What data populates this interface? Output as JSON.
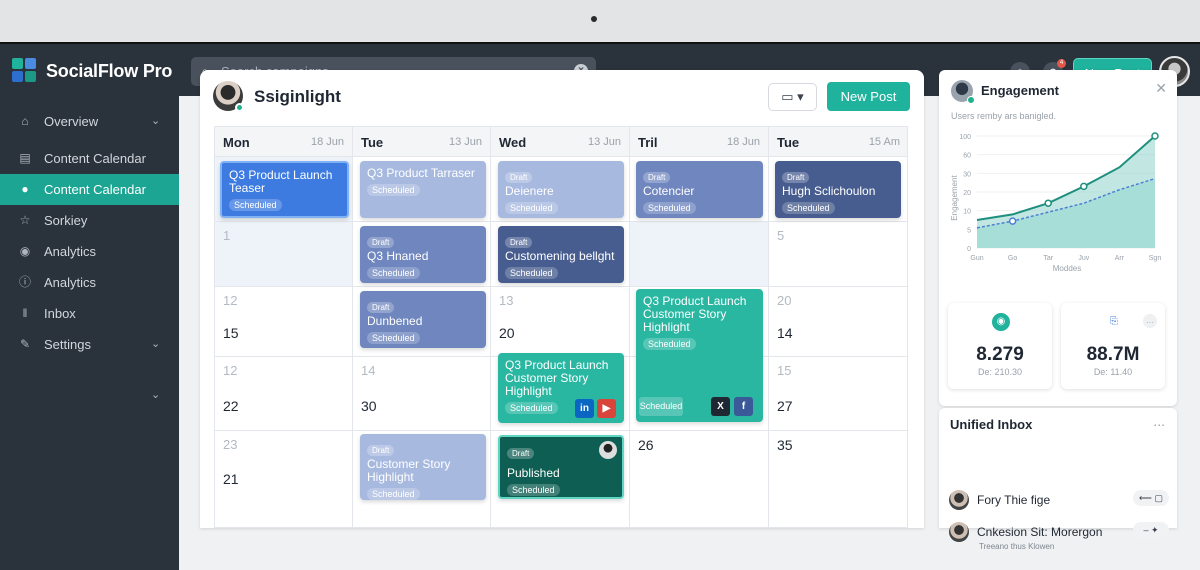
{
  "app": {
    "brand": "SocialFlow Pro"
  },
  "colors": {
    "accent": "#1fb29c",
    "sidebar": "#2a323c",
    "active": "#1ba592"
  },
  "search": {
    "placeholder": "Search campaigns"
  },
  "topbar": {
    "new_post": "New Post",
    "notif_count": "4"
  },
  "sidebar": {
    "items": [
      {
        "label": "Overview",
        "icon": "home-icon",
        "chevron": true
      },
      {
        "label": "Content Calendar",
        "icon": "calendar-icon",
        "chevron": false
      },
      {
        "label": "Content Calendar",
        "icon": "profile-icon",
        "chevron": false,
        "active": true
      },
      {
        "label": "Sorkiey",
        "icon": "star-icon",
        "chevron": false
      },
      {
        "label": "Analytics",
        "icon": "chat-icon",
        "chevron": false
      },
      {
        "label": "Analytics",
        "icon": "info-icon",
        "chevron": false
      },
      {
        "label": "Inbox",
        "icon": "bars-icon",
        "chevron": false
      },
      {
        "label": "Settings",
        "icon": "wrench-icon",
        "chevron": true
      }
    ]
  },
  "main": {
    "title": "Ssiginlight",
    "new_post": "New Post",
    "columns": [
      {
        "day": "Mon",
        "date": "18 Jun"
      },
      {
        "day": "Tue",
        "date": "13 Jun"
      },
      {
        "day": "Wed",
        "date": "13 Jun"
      },
      {
        "day": "Tril",
        "date": "18 Jun"
      },
      {
        "day": "Tue",
        "date": "15 Am"
      }
    ],
    "dates": {
      "r1": [
        "1",
        "",
        "",
        "",
        "5"
      ],
      "r2": [
        "12",
        "",
        "13",
        "",
        "20"
      ],
      "r2b": [
        "15",
        "",
        "20",
        "",
        "14"
      ],
      "r3": [
        "12",
        "14",
        "",
        "",
        "15"
      ],
      "r3b": [
        "22",
        "30",
        "",
        "",
        "27"
      ],
      "r4": [
        "23",
        "",
        "",
        "26",
        "35"
      ],
      "r4b": [
        "21",
        "",
        "",
        "",
        ""
      ]
    },
    "events": {
      "e1": {
        "title": "Q3 Product Launch Teaser",
        "status": "Scheduled"
      },
      "e2": {
        "title": "Q3 Product Tarraser",
        "status": "Scheduled"
      },
      "e3": {
        "tag": "Draft",
        "title": "Deienere",
        "status": "Scheduled"
      },
      "e4": {
        "tag": "Draft",
        "title": "Cotencier",
        "status": "Scheduled"
      },
      "e5": {
        "tag": "Draft",
        "title": "Hugh Sclichoulon",
        "status": "Scheduled"
      },
      "e6": {
        "tag": "Draft",
        "title": "Q3 Hnaned",
        "status": "Scheduled"
      },
      "e7": {
        "tag": "Draft",
        "title": "Customening bellght",
        "status": "Scheduled"
      },
      "e8": {
        "tag": "Draft",
        "title": "Dunbened",
        "status": "Scheduled"
      },
      "e9": {
        "title": "Q3 Product Launch Customer Story Highlight",
        "status": "Scheduled"
      },
      "e10": {
        "title": "Q3 Product Launch Customer Story Highlight",
        "status": "Scheduled"
      },
      "e11": {
        "tag": "Draft",
        "title": "Customer Story Highlight",
        "status": "Scheduled"
      },
      "e12": {
        "tag": "Draft",
        "title": "Published",
        "status": "Scheduled"
      }
    }
  },
  "engagement": {
    "title": "Engagement",
    "subtitle": "Users remby ars banigled.",
    "chart_data": {
      "type": "area",
      "title": "",
      "ylabel": "Engagement",
      "xlabel": "Moddes",
      "x": [
        "Gun",
        "Go",
        "Tar",
        "Juv",
        "Arr",
        "Sgn"
      ],
      "yticks": [
        "100",
        "60",
        "30",
        "20",
        "10",
        "5",
        "0"
      ],
      "series": [
        {
          "values": [
            25,
            30,
            40,
            55,
            72,
            100
          ]
        },
        {
          "values": [
            18,
            24,
            32,
            40,
            52,
            62
          ]
        }
      ]
    },
    "stats": [
      {
        "value": "8.279",
        "sub": "De: 210.30"
      },
      {
        "value": "88.7M",
        "sub": "De: 11.40"
      }
    ]
  },
  "inbox": {
    "title": "Unified Inbox",
    "more": "...",
    "messages": [
      {
        "name": "Fory Thie fige",
        "sub": "",
        "action": "⟵ ▢"
      },
      {
        "name": "Cnkesion Sit: Morergon",
        "sub": "Treeano thus Klowen",
        "action": "– ✦"
      }
    ]
  }
}
